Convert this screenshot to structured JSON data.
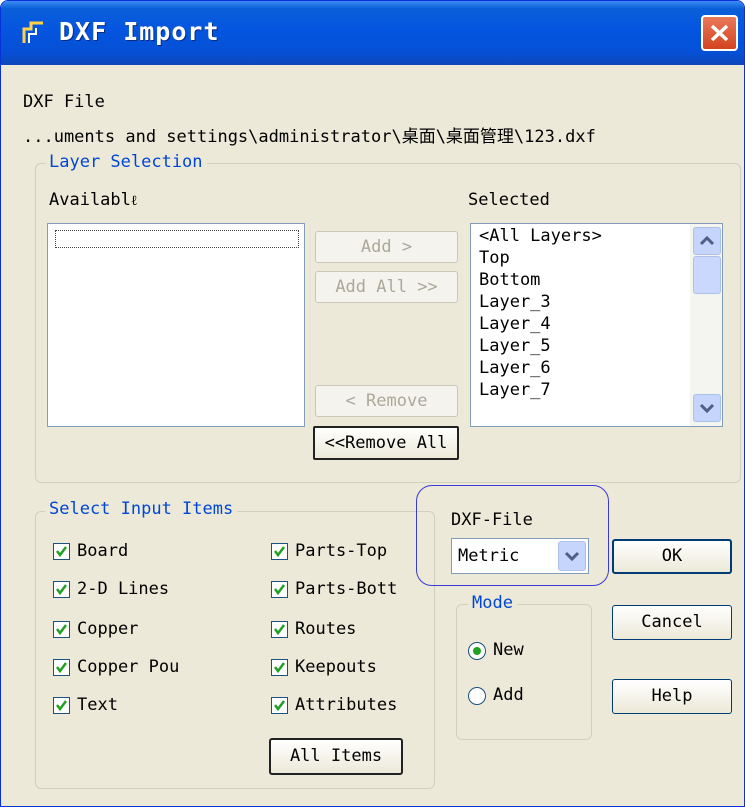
{
  "window": {
    "title": "DXF Import",
    "close_label": "X"
  },
  "file": {
    "label": "DXF File",
    "path": "...uments and settings\\administrator\\桌面\\桌面管理\\123.dxf"
  },
  "layer_selection": {
    "title": "Layer Selection",
    "available_label": "Availabl\u0006e",
    "available_label_shown": "Availabl",
    "selected_label": "Selected",
    "add": "Add >",
    "add_all": "Add All >>",
    "remove": "< Remove",
    "remove_all": "<<Remove All",
    "selected_items": [
      "<All Layers>",
      "Top",
      "Bottom",
      "Layer_3",
      "Layer_4",
      "Layer_5",
      "Layer_6",
      "Layer_7"
    ]
  },
  "input_items": {
    "title": "Select Input Items",
    "col1": [
      "Board",
      "2-D Lines",
      "Copper",
      "Copper Pou",
      "Text"
    ],
    "col2": [
      "Parts-Top",
      "Parts-Bott",
      "Routes",
      "Keepouts",
      "Attributes"
    ],
    "all_items": "All  Items"
  },
  "dxf_file": {
    "label": "DXF-File",
    "value": "Metric"
  },
  "mode": {
    "title": "Mode",
    "new": "New",
    "add": "Add",
    "selected": "New"
  },
  "buttons": {
    "ok": "OK",
    "cancel": "Cancel",
    "help": "Help"
  },
  "colors": {
    "titlebar": "#0555e0",
    "group_title": "#0046d5",
    "highlight": "#3a3ad6"
  }
}
